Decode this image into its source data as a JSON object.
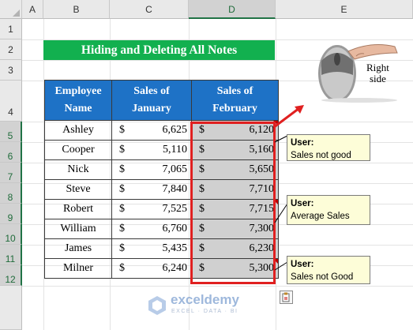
{
  "columns": [
    "A",
    "B",
    "C",
    "D",
    "E"
  ],
  "selected_column": "D",
  "rows": [
    "1",
    "2",
    "3",
    "4",
    "5",
    "6",
    "7",
    "8",
    "9",
    "10",
    "11",
    "12"
  ],
  "selected_rows": [
    "5",
    "6",
    "7",
    "8",
    "9",
    "10",
    "11",
    "12"
  ],
  "title": "Hiding and Deleting All Notes",
  "table": {
    "headers": [
      "Employee Name",
      "Sales of January",
      "Sales of February"
    ],
    "currency_symbol": "$",
    "rows": [
      {
        "name": "Ashley",
        "jan": "6,625",
        "feb": "6,120"
      },
      {
        "name": "Cooper",
        "jan": "5,110",
        "feb": "5,160"
      },
      {
        "name": "Nick",
        "jan": "7,065",
        "feb": "5,650"
      },
      {
        "name": "Steve",
        "jan": "7,840",
        "feb": "7,710"
      },
      {
        "name": "Robert",
        "jan": "7,525",
        "feb": "7,715"
      },
      {
        "name": "William",
        "jan": "6,760",
        "feb": "7,300"
      },
      {
        "name": "James",
        "jan": "5,435",
        "feb": "6,230"
      },
      {
        "name": "Milner",
        "jan": "6,240",
        "feb": "5,300"
      }
    ]
  },
  "notes": [
    {
      "author": "User:",
      "text": "Sales not good"
    },
    {
      "author": "User:",
      "text": "Average Sales"
    },
    {
      "author": "User:",
      "text": "Sales not Good"
    }
  ],
  "mouse": {
    "label_line1": "Right",
    "label_line2": "side",
    "icon": "mouse-right-click-icon"
  },
  "watermark": {
    "name": "exceldemy",
    "tagline": "EXCEL · DATA · BI"
  },
  "colors": {
    "header_blue": "#1e72c6",
    "title_green": "#12b04f",
    "highlight_red": "#e02020",
    "note_bg": "#fdfdd8",
    "selected_cell": "#d0d0d0"
  }
}
